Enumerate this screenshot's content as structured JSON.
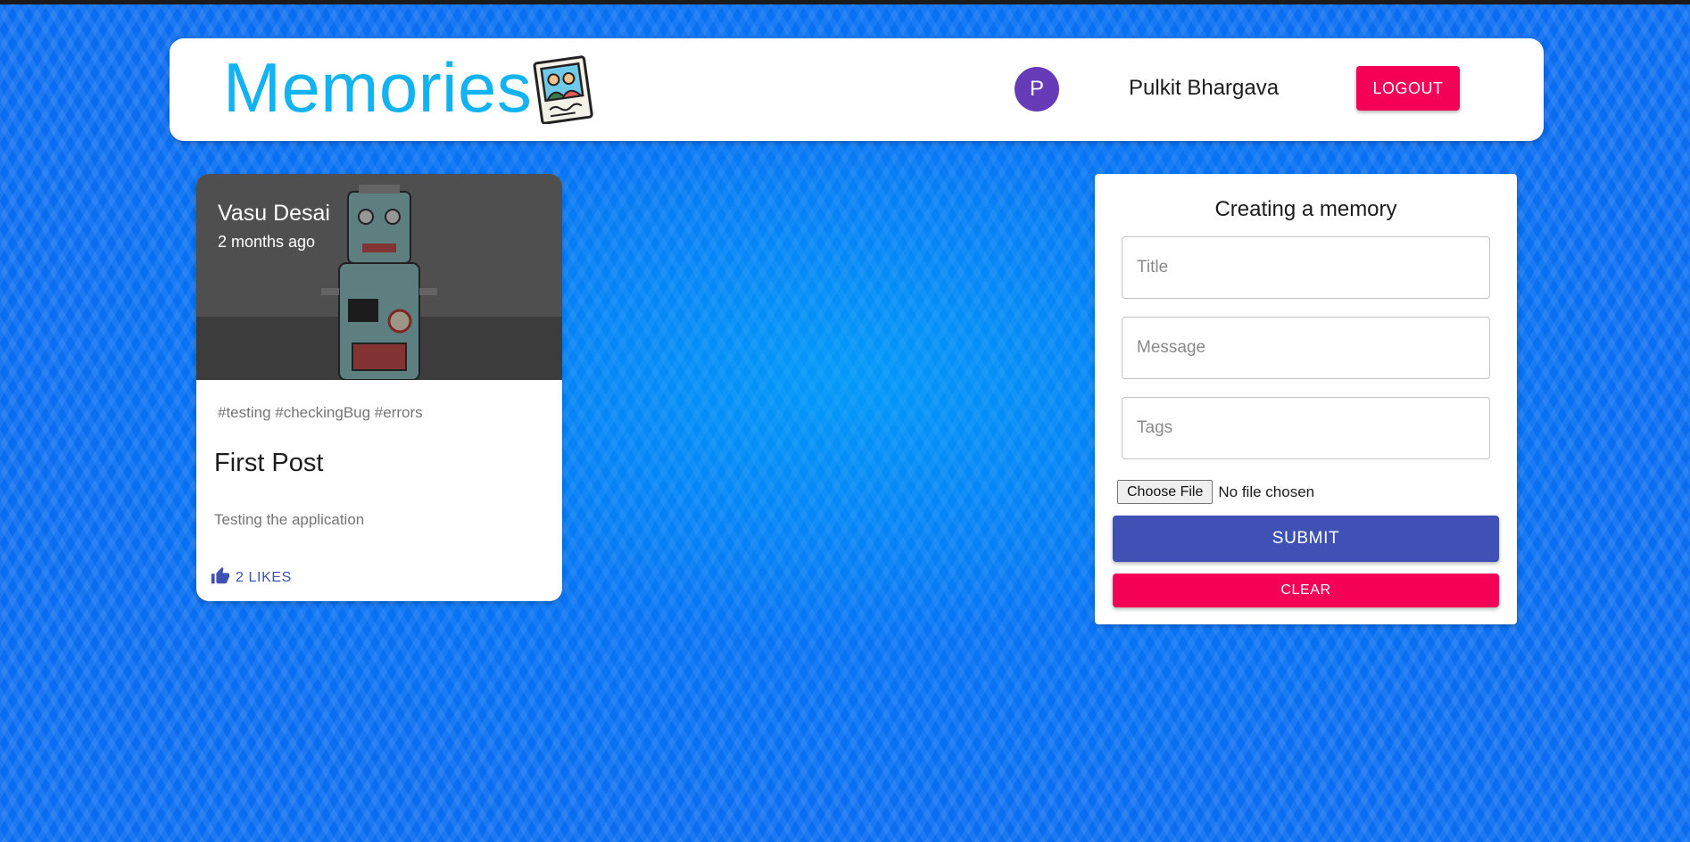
{
  "header": {
    "brand": "Memories",
    "user_initial": "P",
    "user_name": "Pulkit Bhargava",
    "logout_label": "LOGOUT"
  },
  "posts": [
    {
      "author": "Vasu Desai",
      "time_ago": "2 months ago",
      "tags": "#testing #checkingBug #errors",
      "title": "First Post",
      "message": "Testing the application",
      "likes_label": "2 LIKES"
    }
  ],
  "form": {
    "heading": "Creating a memory",
    "title_placeholder": "Title",
    "message_placeholder": "Message",
    "tags_placeholder": "Tags",
    "file_button_label": "Choose File",
    "file_status": "No file chosen",
    "submit_label": "SUBMIT",
    "clear_label": "CLEAR"
  },
  "colors": {
    "brand": "#12b3f0",
    "primary": "#3f51b5",
    "secondary": "#f50057",
    "avatar": "#673ab7"
  },
  "icons": {
    "brand_logo": "photo-memories-icon",
    "like": "thumb-up-icon"
  }
}
